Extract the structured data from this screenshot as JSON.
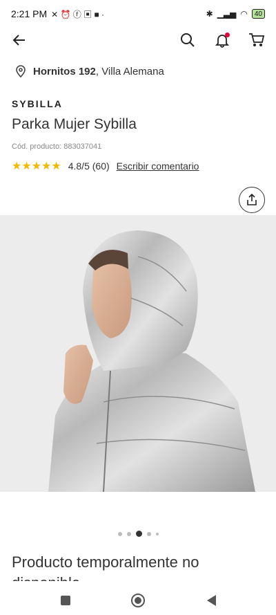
{
  "status_bar": {
    "time": "2:21 PM",
    "battery": "40"
  },
  "header": {
    "back_icon": "arrow-left-icon",
    "search_icon": "search-icon",
    "notifications_icon": "bell-icon",
    "cart_icon": "cart-icon"
  },
  "location": {
    "street": "Hornitos 192",
    "city": ", Villa Alemana"
  },
  "product": {
    "brand": "SYBILLA",
    "title": "Parka Mujer Sybilla",
    "sku": "Cód. producto: 883037041",
    "stars": "★★★★★",
    "rating": "4.8/5 (60)",
    "review_link": "Escribir comentario",
    "availability": "Producto temporalmente no disponible",
    "image_index": 3,
    "image_count": 5
  },
  "colors": {
    "accent": "#e4003b",
    "star": "#f5b800"
  }
}
